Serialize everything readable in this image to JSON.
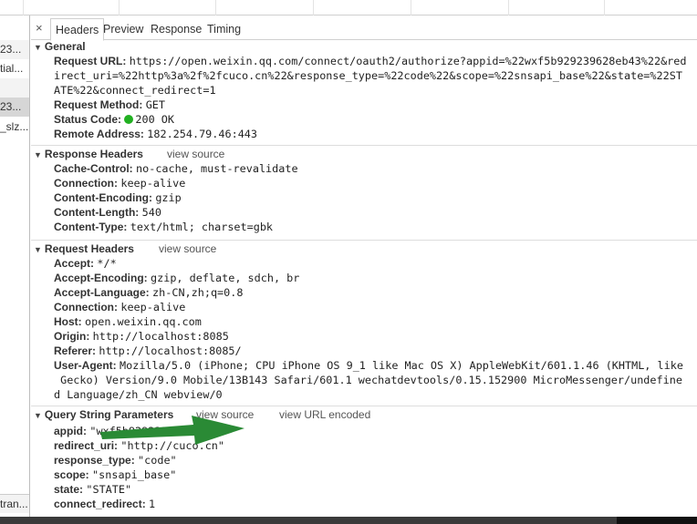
{
  "sidebar": {
    "items": [
      "23...",
      "tial...",
      "",
      "23...",
      "_slz...",
      "tran..."
    ]
  },
  "tabs": {
    "close": "×",
    "items": [
      "Headers",
      "Preview",
      "Response",
      "Timing"
    ]
  },
  "general": {
    "title": "General",
    "request_url_label": "Request URL:",
    "request_url_lines": [
      "https://open.weixin.qq.com/connect/oauth2/authorize?appid=%22wxf5b929239628eb43%22&red",
      "irect_uri=%22http%3a%2f%2fcuco.cn%22&response_type=%22code%22&scope=%22snsapi_base%22&state=%22ST",
      "ATE%22&connect_redirect=1"
    ],
    "method_label": "Request Method:",
    "method": "GET",
    "status_label": "Status Code:",
    "status": "200 OK",
    "status_color": "#21b021",
    "remote_label": "Remote Address:",
    "remote": "182.254.79.46:443"
  },
  "response_headers": {
    "title": "Response Headers",
    "view_source": "view source",
    "items": [
      {
        "k": "Cache-Control:",
        "v": "no-cache, must-revalidate"
      },
      {
        "k": "Connection:",
        "v": "keep-alive"
      },
      {
        "k": "Content-Encoding:",
        "v": "gzip"
      },
      {
        "k": "Content-Length:",
        "v": "540"
      },
      {
        "k": "Content-Type:",
        "v": "text/html; charset=gbk"
      }
    ]
  },
  "request_headers": {
    "title": "Request Headers",
    "view_source": "view source",
    "items": [
      {
        "k": "Accept:",
        "v": "*/*"
      },
      {
        "k": "Accept-Encoding:",
        "v": "gzip, deflate, sdch, br"
      },
      {
        "k": "Accept-Language:",
        "v": "zh-CN,zh;q=0.8"
      },
      {
        "k": "Connection:",
        "v": "keep-alive"
      },
      {
        "k": "Host:",
        "v": "open.weixin.qq.com"
      },
      {
        "k": "Origin:",
        "v": "http://localhost:8085"
      },
      {
        "k": "Referer:",
        "v": "http://localhost:8085/"
      }
    ],
    "user_agent_label": "User-Agent:",
    "user_agent_lines": [
      "Mozilla/5.0 (iPhone; CPU iPhone OS 9_1 like Mac OS X) AppleWebKit/601.1.46 (KHTML, like",
      " Gecko) Version/9.0 Mobile/13B143 Safari/601.1 wechatdevtools/0.15.152900 MicroMessenger/undefine",
      "d Language/zh_CN webview/0"
    ]
  },
  "query": {
    "title": "Query String Parameters",
    "view_source": "view source",
    "view_url_encoded": "view URL encoded",
    "items": [
      {
        "k": "appid:",
        "v": "\"wxf5b929239628eb43\""
      },
      {
        "k": "redirect_uri:",
        "v": "\"http://cuco.cn\""
      },
      {
        "k": "response_type:",
        "v": "\"code\""
      },
      {
        "k": "scope:",
        "v": "\"snsapi_base\""
      },
      {
        "k": "state:",
        "v": "\"STATE\""
      },
      {
        "k": "connect_redirect:",
        "v": "1"
      }
    ]
  },
  "annotation": {
    "arrow_color": "#2a8a35"
  }
}
